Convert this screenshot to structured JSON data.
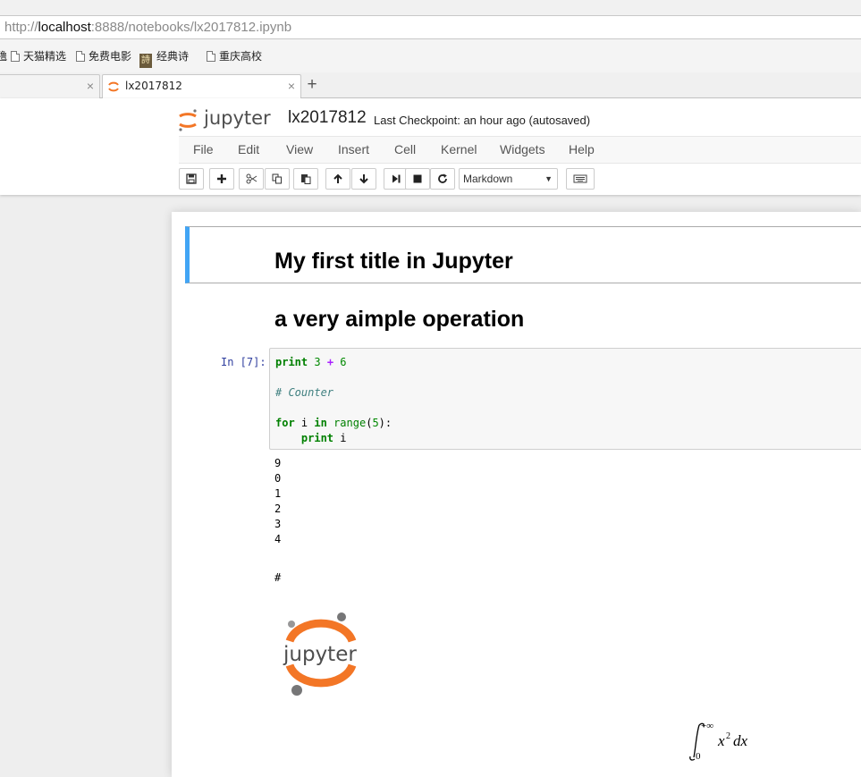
{
  "browser": {
    "url_scheme": "http://",
    "url_host": "localhost",
    "url_rest": ":8888/notebooks/lx2017812.ipynb",
    "bookmarks": [
      {
        "label": "天猫精选",
        "icon": "doc-icon"
      },
      {
        "label": "免费电影",
        "icon": "doc-icon"
      },
      {
        "label": "经典诗",
        "icon": "poem-icon"
      },
      {
        "label": "重庆高校",
        "icon": "doc-icon"
      }
    ],
    "bookmark_edge_fragment": "氇",
    "tabs": [
      {
        "label": "",
        "active": false
      },
      {
        "label": "lx2017812",
        "active": true
      }
    ],
    "new_tab_label": "+",
    "tab_close_label": "×"
  },
  "header": {
    "logo_text": "jupyter",
    "notebook_name": "lx2017812",
    "checkpoint": "Last Checkpoint: an hour ago (autosaved)"
  },
  "menu": {
    "items": [
      "File",
      "Edit",
      "View",
      "Insert",
      "Cell",
      "Kernel",
      "Widgets",
      "Help"
    ]
  },
  "toolbar": {
    "cell_type": "Markdown",
    "buttons": [
      "save-icon",
      "add-icon",
      "cut-icon",
      "copy-icon",
      "paste-icon",
      "move-up-icon",
      "move-down-icon",
      "run-icon",
      "stop-icon",
      "restart-icon",
      "keyboard-icon"
    ]
  },
  "notebook": {
    "title_h1": "My first title in Jupyter",
    "title_h2": "a very aimple operation",
    "in_prompt": "In [7]:",
    "code": {
      "line1_kw": "print",
      "line1_a": "3",
      "line1_op": "+",
      "line1_b": "6",
      "comment": "# Counter",
      "for_kw": "for",
      "var_i": "i",
      "in_kw": "in",
      "range_fn": "range",
      "range_open": "(",
      "range_arg": "5",
      "range_close": "):",
      "print2_kw": "print",
      "print2_arg": "i"
    },
    "output_lines": [
      "9",
      "0",
      "1",
      "2",
      "3",
      "4"
    ],
    "md_hash": "#",
    "logo_text": "jupyter",
    "math": {
      "upper": "+∞",
      "lower": "0",
      "base": "x",
      "exponent": "2",
      "dx": "dx"
    }
  },
  "colors": {
    "selected_cell_border": "#42a5f5",
    "jupyter_orange": "#f37626",
    "prompt_blue": "#303f9f"
  }
}
